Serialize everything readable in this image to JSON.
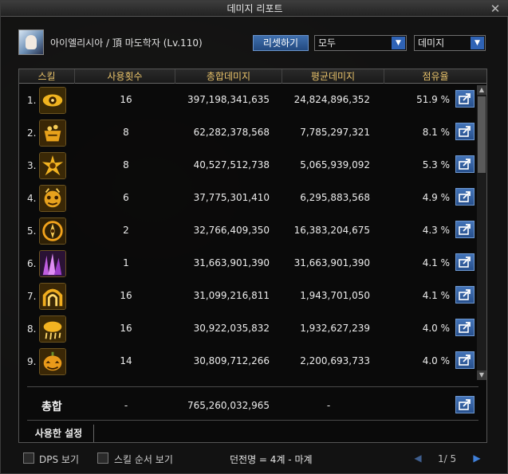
{
  "window": {
    "title": "데미지 리포트",
    "close_label": "✕"
  },
  "character": {
    "name": "아이엘리시아 / 頂 마도학자 (Lv.110)"
  },
  "toolbar": {
    "reset_label": "리셋하기",
    "filter_value": "모두",
    "metric_value": "데미지"
  },
  "table": {
    "columns": [
      "스킬",
      "사용횟수",
      "총합데미지",
      "평균데미지",
      "점유율"
    ],
    "rows": [
      {
        "rank": "1.",
        "icon": "eye-skill-icon",
        "uses": "16",
        "total": "397,198,341,635",
        "avg": "24,824,896,352",
        "share": "51.9 %"
      },
      {
        "rank": "2.",
        "icon": "cauldron-skill-icon",
        "uses": "8",
        "total": "62,282,378,568",
        "avg": "7,785,297,321",
        "share": "8.1 %"
      },
      {
        "rank": "3.",
        "icon": "burst-skill-icon",
        "uses": "8",
        "total": "40,527,512,738",
        "avg": "5,065,939,092",
        "share": "5.3 %"
      },
      {
        "rank": "4.",
        "icon": "imp-skill-icon",
        "uses": "6",
        "total": "37,775,301,410",
        "avg": "6,295,883,568",
        "share": "4.9 %"
      },
      {
        "rank": "5.",
        "icon": "compass-skill-icon",
        "uses": "2",
        "total": "32,766,409,350",
        "avg": "16,383,204,675",
        "share": "4.3 %"
      },
      {
        "rank": "6.",
        "icon": "purple-spike-skill-icon",
        "uses": "1",
        "total": "31,663,901,390",
        "avg": "31,663,901,390",
        "share": "4.1 %"
      },
      {
        "rank": "7.",
        "icon": "arch-skill-icon",
        "uses": "16",
        "total": "31,099,216,811",
        "avg": "1,943,701,050",
        "share": "4.1 %"
      },
      {
        "rank": "8.",
        "icon": "cloud-skill-icon",
        "uses": "16",
        "total": "30,922,035,832",
        "avg": "1,932,627,239",
        "share": "4.0 %"
      },
      {
        "rank": "9.",
        "icon": "pumpkin-skill-icon",
        "uses": "14",
        "total": "30,809,712,266",
        "avg": "2,200,693,733",
        "share": "4.0 %"
      }
    ],
    "total_row": {
      "label": "총합",
      "uses": "-",
      "total": "765,260,032,965",
      "avg": "-"
    }
  },
  "settings_tab": {
    "label": "사용한 설정"
  },
  "footer": {
    "dps_label": "DPS 보기",
    "skill_order_label": "스킬 순서 보기",
    "status": "던전명 = 4계 - 마계",
    "page": "1/ 5"
  },
  "colors": {
    "accent_blue": "#2f63b5",
    "header_gold": "#e8c26a",
    "skill_frame": "#6b5320"
  }
}
